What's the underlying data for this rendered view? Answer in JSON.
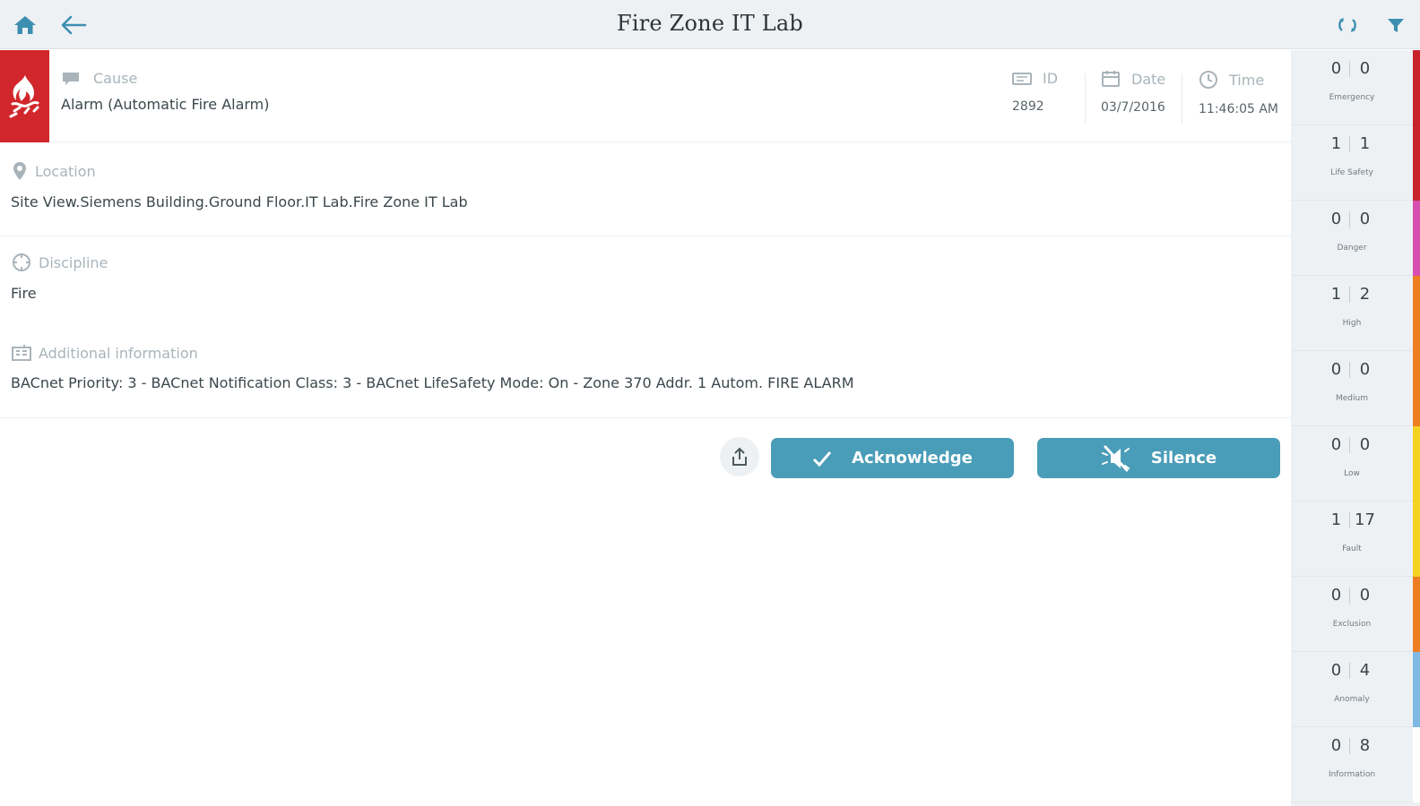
{
  "header": {
    "title": "Fire Zone IT Lab",
    "home_icon": "home-icon",
    "back_icon": "arrow-left-icon",
    "refresh_icon": "refresh-icon",
    "filter_icon": "filter-icon"
  },
  "alarm": {
    "cause_label": "Cause",
    "cause_value": "Alarm (Automatic Fire Alarm)",
    "id_label": "ID",
    "id_value": "2892",
    "date_label": "Date",
    "date_value": "03/7/2016",
    "time_label": "Time",
    "time_value": "11:46:05 AM",
    "tile_color": "#d1272c"
  },
  "location": {
    "label": "Location",
    "value": "Site View.Siemens Building.Ground Floor.IT Lab.Fire Zone IT Lab"
  },
  "discipline": {
    "label": "Discipline",
    "value": "Fire"
  },
  "additional": {
    "label": "Additional information",
    "value": "BACnet Priority: 3 - BACnet Notification Class: 3 - BACnet LifeSafety Mode: On - Zone 370 Addr. 1 Autom. FIRE ALARM"
  },
  "actions": {
    "acknowledge": "Acknowledge",
    "silence": "Silence",
    "accent": "#4a9db8"
  },
  "categories": [
    {
      "a": "0",
      "b": "0",
      "name": "Emergency",
      "color": "#c8232a"
    },
    {
      "a": "1",
      "b": "1",
      "name": "Life Safety",
      "color": "#c8232a"
    },
    {
      "a": "0",
      "b": "0",
      "name": "Danger",
      "color": "#d64fb0"
    },
    {
      "a": "1",
      "b": "2",
      "name": "High",
      "color": "#ef7d22"
    },
    {
      "a": "0",
      "b": "0",
      "name": "Medium",
      "color": "#ef7d22"
    },
    {
      "a": "0",
      "b": "0",
      "name": "Low",
      "color": "#f4d21f"
    },
    {
      "a": "1",
      "b": "17",
      "name": "Fault",
      "color": "#f4d21f"
    },
    {
      "a": "0",
      "b": "0",
      "name": "Exclusion",
      "color": "#ef7d22"
    },
    {
      "a": "0",
      "b": "4",
      "name": "Anomaly",
      "color": "#7fb8e3"
    },
    {
      "a": "0",
      "b": "8",
      "name": "Information",
      "color": "#ffffff"
    }
  ]
}
